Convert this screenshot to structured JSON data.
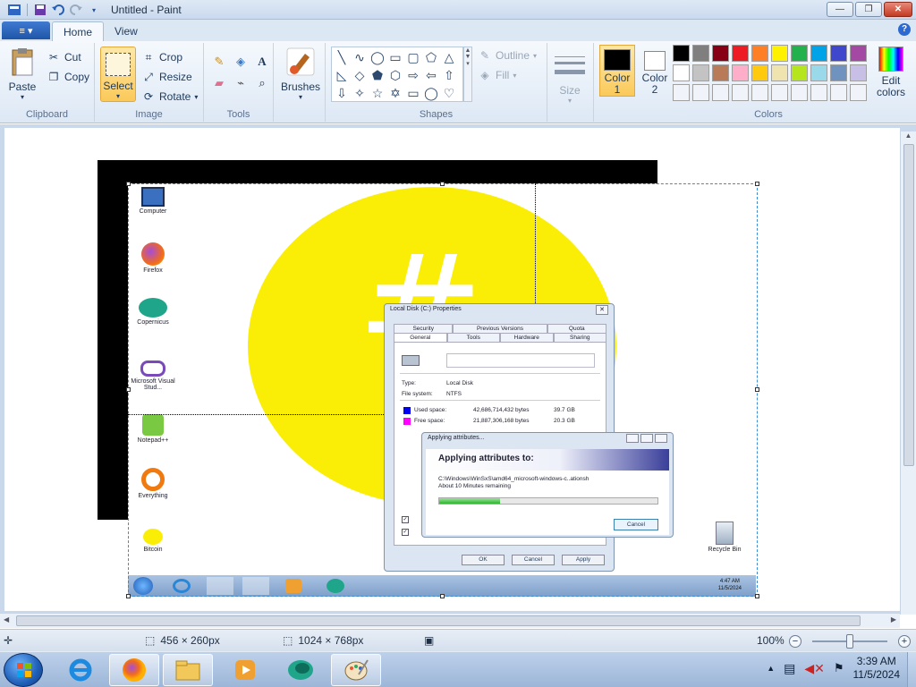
{
  "window": {
    "title": "Untitled - Paint",
    "controls": {
      "minimize": "—",
      "maximize": "❐",
      "close": "✕"
    }
  },
  "ribbon": {
    "file_menu": "≡ ▾",
    "tabs": [
      {
        "label": "Home",
        "active": true
      },
      {
        "label": "View",
        "active": false
      }
    ],
    "help": "?",
    "clipboard": {
      "paste": "Paste",
      "cut": "Cut",
      "copy": "Copy",
      "group_label": "Clipboard"
    },
    "image": {
      "select": "Select",
      "crop": "Crop",
      "resize": "Resize",
      "rotate": "Rotate",
      "group_label": "Image"
    },
    "tools": {
      "group_label": "Tools"
    },
    "brushes": {
      "label": "Brushes"
    },
    "shapes": {
      "outline": "Outline",
      "fill": "Fill",
      "group_label": "Shapes"
    },
    "size": {
      "label": "Size"
    },
    "colors": {
      "color1_label": "Color",
      "color1_num": "1",
      "color2_label": "Color",
      "color2_num": "2",
      "edit_colors": "Edit colors",
      "group_label": "Colors",
      "color1": "#000000",
      "color2": "#ffffff",
      "palette_row1": [
        "#000000",
        "#7f7f7f",
        "#880015",
        "#ed1c24",
        "#ff7f27",
        "#fff200",
        "#22b14c",
        "#00a2e8",
        "#3f48cc",
        "#a349a4"
      ],
      "palette_row2": [
        "#ffffff",
        "#c3c3c3",
        "#b97a57",
        "#ffaec9",
        "#ffc90e",
        "#efe4b0",
        "#b5e61d",
        "#99d9ea",
        "#7092be",
        "#c8bfe7"
      ],
      "palette_row3": [
        "#f0f4fa",
        "#f0f4fa",
        "#f0f4fa",
        "#f0f4fa",
        "#f0f4fa",
        "#f0f4fa",
        "#f0f4fa",
        "#f0f4fa",
        "#f0f4fa",
        "#f0f4fa"
      ]
    }
  },
  "canvas_image": {
    "desktop_icons": [
      "Computer",
      "Firefox",
      "Copernicus",
      "Microsoft Visual Stud...",
      "Notepad++",
      "Everything",
      "Bitcoin"
    ],
    "recycle_bin": "Recycle Bin",
    "properties_dialog": {
      "title": "Local Disk (C:) Properties",
      "tabs_row1": [
        "Security",
        "Previous Versions",
        "Quota"
      ],
      "tabs_row2": [
        "General",
        "Tools",
        "Hardware",
        "Sharing"
      ],
      "type_label": "Type:",
      "type_value": "Local Disk",
      "fs_label": "File system:",
      "fs_value": "NTFS",
      "used_label": "Used space:",
      "used_value": "42,686,714,432 bytes",
      "used_gb": "39.7 GB",
      "free_label": "Free space:",
      "free_value": "21,887,306,168 bytes",
      "free_gb": "20.3 GB",
      "ok": "OK",
      "cancel": "Cancel",
      "apply": "Apply"
    },
    "applying_dialog": {
      "title": "Applying attributes...",
      "heading": "Applying attributes to:",
      "path": "C:\\Windows\\WinSxS\\amd64_microsoft-windows-c..ationsh",
      "time_left": "About 10 Minutes remaining",
      "cancel": "Cancel",
      "progress": 0.28
    },
    "inner_clock": {
      "time": "4:47 AM",
      "date": "11/5/2024"
    },
    "bigsymbol": "#"
  },
  "statusbar": {
    "selection_size": "456 × 260px",
    "image_size": "1024 × 768px",
    "zoom": "100%",
    "zoom_minus": "−",
    "zoom_plus": "+"
  },
  "taskbar": {
    "time": "3:39 AM",
    "date": "11/5/2024"
  }
}
